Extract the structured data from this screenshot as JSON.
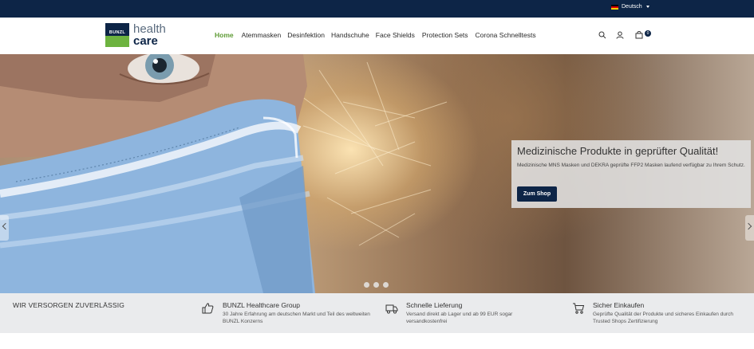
{
  "topbar": {
    "language": "Deutsch"
  },
  "logo": {
    "mark_text": "BUNZL",
    "line1": "health",
    "line2": "care"
  },
  "nav": {
    "items": [
      "Home",
      "Atemmasken",
      "Desinfektion",
      "Handschuhe",
      "Face Shields",
      "Protection Sets",
      "Corona Schnelltests"
    ],
    "active_index": 0
  },
  "cart": {
    "count": "0"
  },
  "icons": {
    "search": "search-icon",
    "account": "user-icon",
    "cart": "cart-icon"
  },
  "hero": {
    "title": "Medizinische Produkte in geprüfter Qualität!",
    "text": "Medizinische MNS Masken und DEKRA geprüfte FFP2 Masken laufend verfügbar zu Ihrem Schutz.",
    "button": "Zum Shop",
    "slides": 3
  },
  "features": {
    "title": "WIR VERSORGEN ZUVERLÄSSIG",
    "items": [
      {
        "icon": "thumbs-up-icon",
        "title": "BUNZL Healthcare Group",
        "text": "30 Jahre Erfahrung am deutschen Markt und Teil des weltweiten BUNZL Konzerns"
      },
      {
        "icon": "truck-icon",
        "title": "Schnelle Lieferung",
        "text": "Versand direkt ab Lager und ab 99 EUR sogar versandkostenfrei"
      },
      {
        "icon": "cart-icon",
        "title": "Sicher Einkaufen",
        "text": "Geprüfte Qualität der Produkte und sicheres Einkaufen durch Trusted Shops Zertifizierung"
      }
    ]
  },
  "colors": {
    "navy": "#0d2547",
    "green": "#6db33f",
    "active_nav": "#5d9a33",
    "feature_bg": "#eaebed"
  }
}
